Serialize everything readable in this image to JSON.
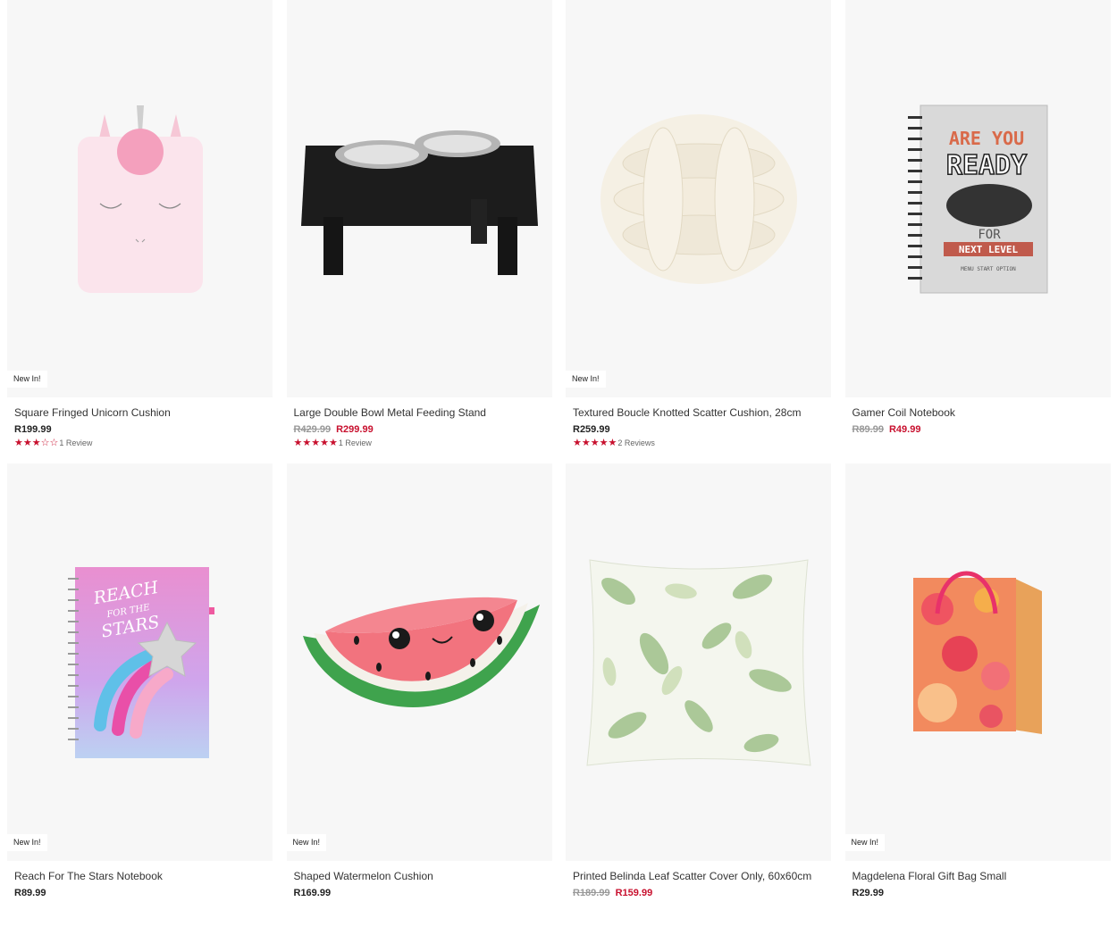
{
  "products": [
    {
      "title": "Square Fringed Unicorn Cushion",
      "badge": "New In!",
      "price": "R199.99",
      "was_price": "",
      "now_price": "",
      "stars": "★★★☆☆",
      "reviews": "1 Review",
      "image_icon": "unicorn-cushion"
    },
    {
      "title": "Large Double Bowl Metal Feeding Stand",
      "badge": "",
      "price": "",
      "was_price": "R429.99",
      "now_price": "R299.99",
      "stars": "★★★★★",
      "reviews": "1 Review",
      "image_icon": "feeding-stand"
    },
    {
      "title": "Textured Boucle Knotted Scatter Cushion, 28cm",
      "badge": "New In!",
      "price": "R259.99",
      "was_price": "",
      "now_price": "",
      "stars": "★★★★★",
      "reviews": "2 Reviews",
      "image_icon": "knot-cushion"
    },
    {
      "title": "Gamer Coil Notebook",
      "badge": "",
      "price": "",
      "was_price": "R89.99",
      "now_price": "R49.99",
      "stars": "",
      "reviews": "",
      "image_icon": "gamer-notebook",
      "cover_text": [
        "ARE YOU",
        "READY",
        "FOR",
        "NEXT LEVEL",
        "MENU START OPTION"
      ]
    },
    {
      "title": "Reach For The Stars Notebook",
      "badge": "New In!",
      "price": "R89.99",
      "was_price": "",
      "now_price": "",
      "stars": "",
      "reviews": "",
      "image_icon": "stars-notebook",
      "cover_text": [
        "REACH",
        "FOR THE",
        "STARS"
      ]
    },
    {
      "title": "Shaped Watermelon Cushion",
      "badge": "New In!",
      "price": "R169.99",
      "was_price": "",
      "now_price": "",
      "stars": "",
      "reviews": "",
      "image_icon": "watermelon-cushion"
    },
    {
      "title": "Printed Belinda Leaf Scatter Cover Only, 60x60cm",
      "badge": "",
      "price": "",
      "was_price": "R189.99",
      "now_price": "R159.99",
      "stars": "",
      "reviews": "",
      "image_icon": "leaf-cushion"
    },
    {
      "title": "Magdelena Floral Gift Bag Small",
      "badge": "New In!",
      "price": "R29.99",
      "was_price": "",
      "now_price": "",
      "stars": "",
      "reviews": "",
      "image_icon": "floral-gift-bag"
    }
  ],
  "colors": {
    "sale": "#c8102e",
    "star": "#c8102e",
    "image_bg": "#f7f7f7"
  }
}
